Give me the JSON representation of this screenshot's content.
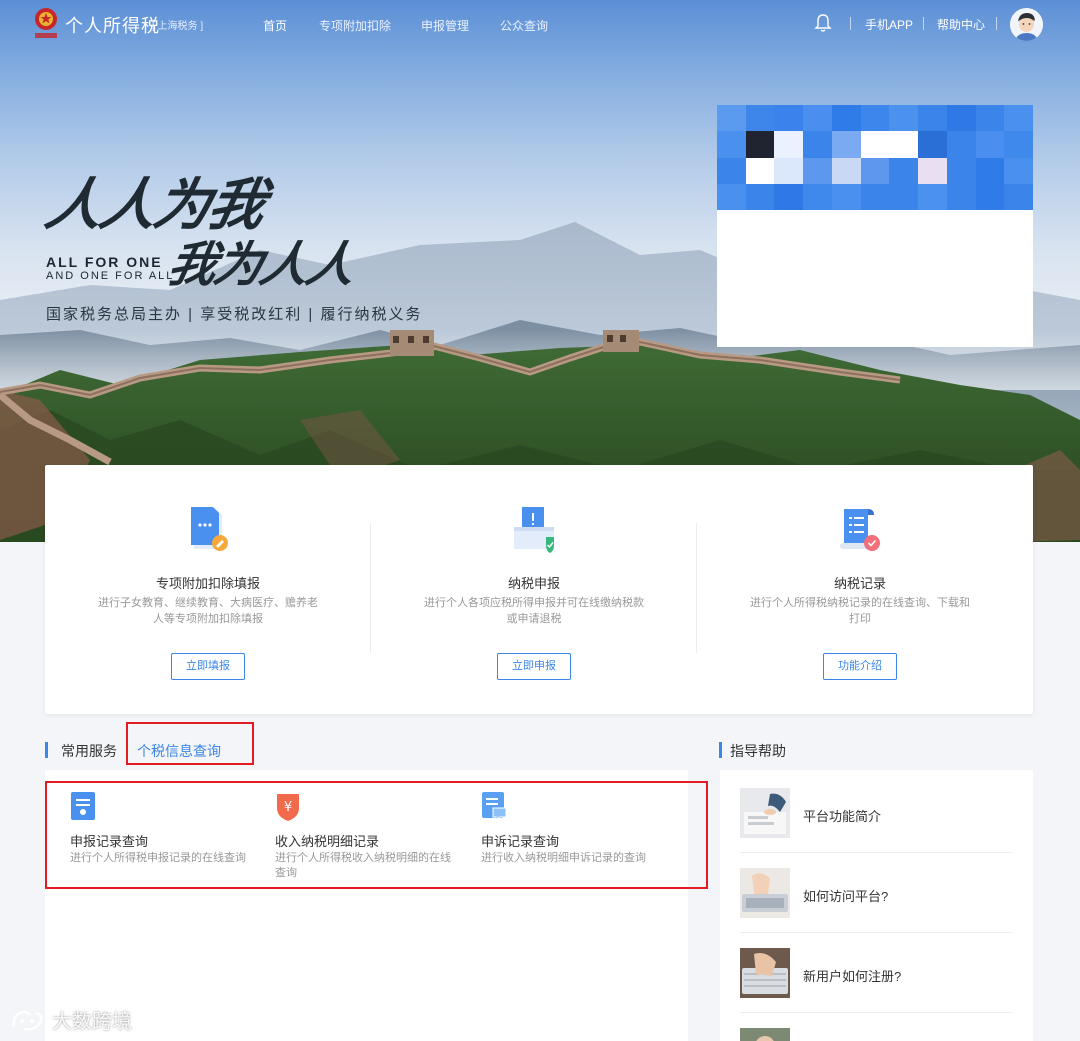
{
  "header": {
    "brand": "个人所得税",
    "region": "[ 上海税务 ]",
    "nav": [
      "首页",
      "专项附加扣除",
      "申报管理",
      "公众查询"
    ],
    "mobile_app": "手机APP",
    "help_center": "帮助中心"
  },
  "hero": {
    "calligraphy_line1": "人人为我",
    "calligraphy_line2": "我为人人",
    "english_line1": "ALL FOR ONE",
    "english_line2": "AND ONE FOR ALL",
    "tagline": "国家税务总局主办 | 享受税改红利 | 履行纳税义务"
  },
  "services": [
    {
      "title": "专项附加扣除填报",
      "desc": "进行子女教育、继续教育、大病医疗、赡养老人等专项附加扣除填报",
      "button": "立即填报",
      "icon": "document-edit-icon"
    },
    {
      "title": "纳税申报",
      "desc": "进行个人各项应税所得申报并可在线缴纳税款或申请退税",
      "button": "立即申报",
      "icon": "tax-declare-icon"
    },
    {
      "title": "纳税记录",
      "desc": "进行个人所得税纳税记录的在线查询、下载和打印",
      "button": "功能介绍",
      "icon": "tax-record-icon"
    }
  ],
  "common": {
    "title": "常用服务",
    "active_tab": "个税信息查询",
    "items": [
      {
        "title": "申报记录查询",
        "desc": "进行个人所得税申报记录的在线查询",
        "icon": "report-record-icon"
      },
      {
        "title": "收入纳税明细记录",
        "desc": "进行个人所得税收入纳税明细的在线查询",
        "icon": "yuan-shield-icon"
      },
      {
        "title": "申诉记录查询",
        "desc": "进行收入纳税明细申诉记录的查询",
        "icon": "appeal-record-icon"
      }
    ]
  },
  "help": {
    "title": "指导帮助",
    "items": [
      "平台功能简介",
      "如何访问平台?",
      "新用户如何注册?"
    ]
  },
  "watermark": "大数跨境",
  "colors": {
    "accent": "#3b86e8",
    "highlight_box": "#e31b23"
  }
}
